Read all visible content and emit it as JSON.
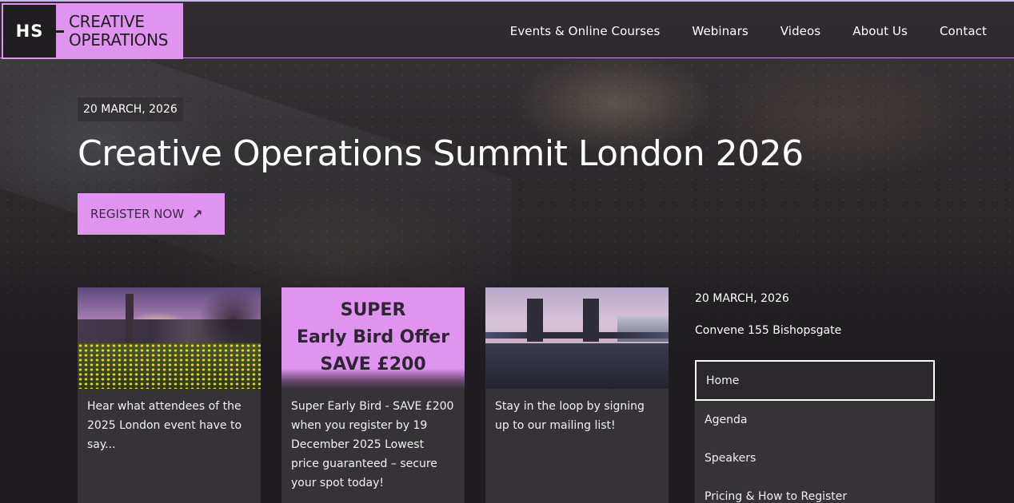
{
  "logo": {
    "badge": "HS",
    "line1": "CREATIVE",
    "line2": "OPERATIONS"
  },
  "nav": [
    {
      "label": "Events & Online Courses"
    },
    {
      "label": "Webinars"
    },
    {
      "label": "Videos"
    },
    {
      "label": "About Us"
    },
    {
      "label": "Contact"
    }
  ],
  "hero": {
    "date": "20 MARCH, 2026",
    "title": "Creative Operations Summit London 2026",
    "register_label": "REGISTER NOW",
    "register_icon": "arrow-up-right-icon"
  },
  "cards": [
    {
      "text": "Hear what attendees of the 2025 London event have to say..."
    },
    {
      "image_lines": [
        "SUPER",
        "Early Bird Offer",
        "SAVE £200"
      ],
      "text": "Super Early Bird - SAVE £200 when you register by 19 December 2025 Lowest price guaranteed – secure your spot today!"
    },
    {
      "text": "Stay in the loop by signing up to our mailing list!"
    }
  ],
  "sidebar": {
    "date": "20 MARCH, 2026",
    "venue": "Convene 155 Bishopsgate",
    "menu": [
      {
        "label": "Home",
        "active": true
      },
      {
        "label": "Agenda"
      },
      {
        "label": "Speakers"
      },
      {
        "label": "Pricing & How to Register"
      }
    ]
  },
  "colors": {
    "accent": "#df94ef",
    "background": "#1e1c1f",
    "card": "#353336"
  }
}
